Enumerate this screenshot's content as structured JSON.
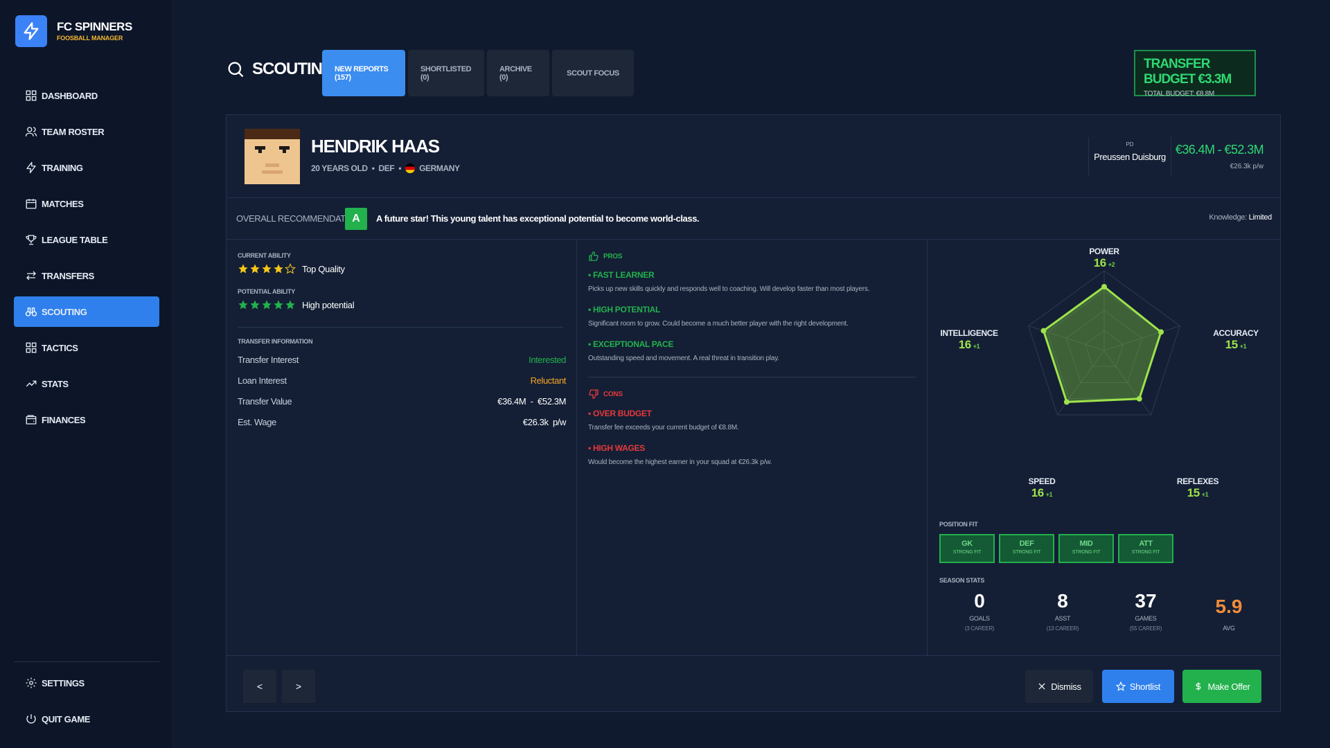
{
  "brand": {
    "name": "FC SPINNERS",
    "subtitle": "FOOSBALL MANAGER"
  },
  "nav": {
    "items": [
      {
        "label": "DASHBOARD",
        "icon": "dashboard-icon"
      },
      {
        "label": "TEAM ROSTER",
        "icon": "users-icon"
      },
      {
        "label": "TRAINING",
        "icon": "bolt-icon"
      },
      {
        "label": "MATCHES",
        "icon": "calendar-icon"
      },
      {
        "label": "LEAGUE TABLE",
        "icon": "trophy-icon"
      },
      {
        "label": "TRANSFERS",
        "icon": "transfer-icon"
      },
      {
        "label": "SCOUTING",
        "icon": "binoculars-icon",
        "active": true
      },
      {
        "label": "TACTICS",
        "icon": "grid-icon"
      },
      {
        "label": "STATS",
        "icon": "trend-icon"
      },
      {
        "label": "FINANCES",
        "icon": "wallet-icon"
      }
    ],
    "bottom": [
      {
        "label": "SETTINGS",
        "icon": "gear-icon"
      },
      {
        "label": "QUIT GAME",
        "icon": "power-icon"
      }
    ]
  },
  "header": {
    "title": "SCOUTING",
    "tabs": [
      {
        "label": "NEW REPORTS (157)",
        "active": true
      },
      {
        "label": "SHORTLISTED (0)"
      },
      {
        "label": "ARCHIVE (0)"
      },
      {
        "label": "SCOUT FOCUS"
      }
    ],
    "budget": {
      "main": "TRANSFER BUDGET €3.3M",
      "sub": "TOTAL BUDGET: €8.8M"
    }
  },
  "player": {
    "name": "HENDRIK HAAS",
    "age": "20 YEARS OLD",
    "position": "DEF",
    "nationality": "GERMANY",
    "club_code": "PD",
    "club_name": "Preussen Duisburg",
    "value_range": "€36.4M - €52.3M",
    "wage": "€26.3k p/w"
  },
  "recommendation": {
    "label": "OVERALL RECOMMENDATION",
    "grade": "A",
    "text": "A future star! This young talent has exceptional potential to become world-class.",
    "knowledge_label": "Knowledge:",
    "knowledge_value": "Limited"
  },
  "ability": {
    "current_label": "CURRENT ABILITY",
    "current_stars": 4,
    "current_text": "Top Quality",
    "potential_label": "POTENTIAL ABILITY",
    "potential_stars": 5,
    "potential_text": "High potential"
  },
  "transfer_info": {
    "title": "TRANSFER INFORMATION",
    "rows": [
      {
        "label": "Transfer Interest",
        "value": "Interested",
        "color": "#22b14c"
      },
      {
        "label": "Loan Interest",
        "value": "Reluctant",
        "color": "#f5a623"
      },
      {
        "label": "Transfer Value",
        "value": "€36.4M  -  €52.3M",
        "color": "#ffffff"
      },
      {
        "label": "Est. Wage",
        "value": "€26.3k  p/w",
        "color": "#ffffff"
      }
    ]
  },
  "pros": {
    "title": "PROS",
    "items": [
      {
        "title": "FAST LEARNER",
        "desc": "Picks up new skills quickly and responds well to coaching. Will develop faster than most players."
      },
      {
        "title": "HIGH POTENTIAL",
        "desc": "Significant room to grow. Could become a much better player with the right development."
      },
      {
        "title": "EXCEPTIONAL PACE",
        "desc": "Outstanding speed and movement. A real threat in transition play."
      }
    ]
  },
  "cons": {
    "title": "CONS",
    "items": [
      {
        "title": "OVER BUDGET",
        "desc": "Transfer fee exceeds your current budget of €8.8M."
      },
      {
        "title": "HIGH WAGES",
        "desc": "Would become the highest earner in your squad at €26.3k p/w."
      }
    ]
  },
  "attributes": [
    {
      "name": "POWER",
      "value": 16,
      "delta": "+2"
    },
    {
      "name": "ACCURACY",
      "value": 15,
      "delta": "+1"
    },
    {
      "name": "REFLEXES",
      "value": 15,
      "delta": "+1"
    },
    {
      "name": "SPEED",
      "value": 16,
      "delta": "+1"
    },
    {
      "name": "INTELLIGENCE",
      "value": 16,
      "delta": "+1"
    }
  ],
  "position_fit": {
    "label": "POSITION FIT",
    "items": [
      {
        "pos": "GK",
        "fit": "STRONG FIT"
      },
      {
        "pos": "DEF",
        "fit": "STRONG FIT"
      },
      {
        "pos": "MID",
        "fit": "STRONG FIT"
      },
      {
        "pos": "ATT",
        "fit": "STRONG FIT"
      }
    ]
  },
  "season_stats": {
    "label": "SEASON STATS",
    "items": [
      {
        "value": "0",
        "label": "GOALS",
        "career": "(3 CAREER)"
      },
      {
        "value": "8",
        "label": "ASST",
        "career": "(13 CAREER)"
      },
      {
        "value": "37",
        "label": "GAMES",
        "career": "(55 CAREER)"
      },
      {
        "value": "5.9",
        "label": "AVG",
        "career": ""
      }
    ]
  },
  "footer": {
    "prev": "<",
    "next": ">",
    "dismiss": "Dismiss",
    "shortlist": "Shortlist",
    "offer": "Make Offer"
  }
}
